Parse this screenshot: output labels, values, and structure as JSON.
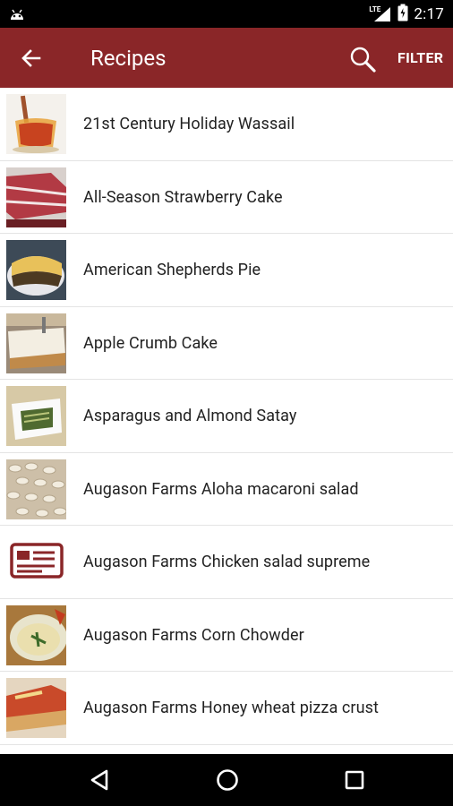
{
  "status_bar": {
    "network": "LTE",
    "time": "2:17"
  },
  "app_bar": {
    "title": "Recipes",
    "filter_label": "FILTER"
  },
  "recipes": [
    {
      "label": "21st Century Holiday Wassail",
      "thumb": "wassail"
    },
    {
      "label": "All-Season Strawberry Cake",
      "thumb": "cake"
    },
    {
      "label": "American Shepherds Pie",
      "thumb": "pie"
    },
    {
      "label": "Apple Crumb Cake",
      "thumb": "crumb"
    },
    {
      "label": "Asparagus and Almond Satay",
      "thumb": "satay"
    },
    {
      "label": "Augason Farms Aloha macaroni salad",
      "thumb": "macaroni"
    },
    {
      "label": "Augason Farms Chicken salad supreme",
      "thumb": "placeholder"
    },
    {
      "label": "Augason Farms Corn Chowder",
      "thumb": "chowder"
    },
    {
      "label": "Augason Farms Honey wheat pizza crust",
      "thumb": "pizza"
    }
  ],
  "colors": {
    "app_bar": "#8a2628",
    "status_bar": "#000000",
    "placeholder_icon": "#8a2628"
  }
}
